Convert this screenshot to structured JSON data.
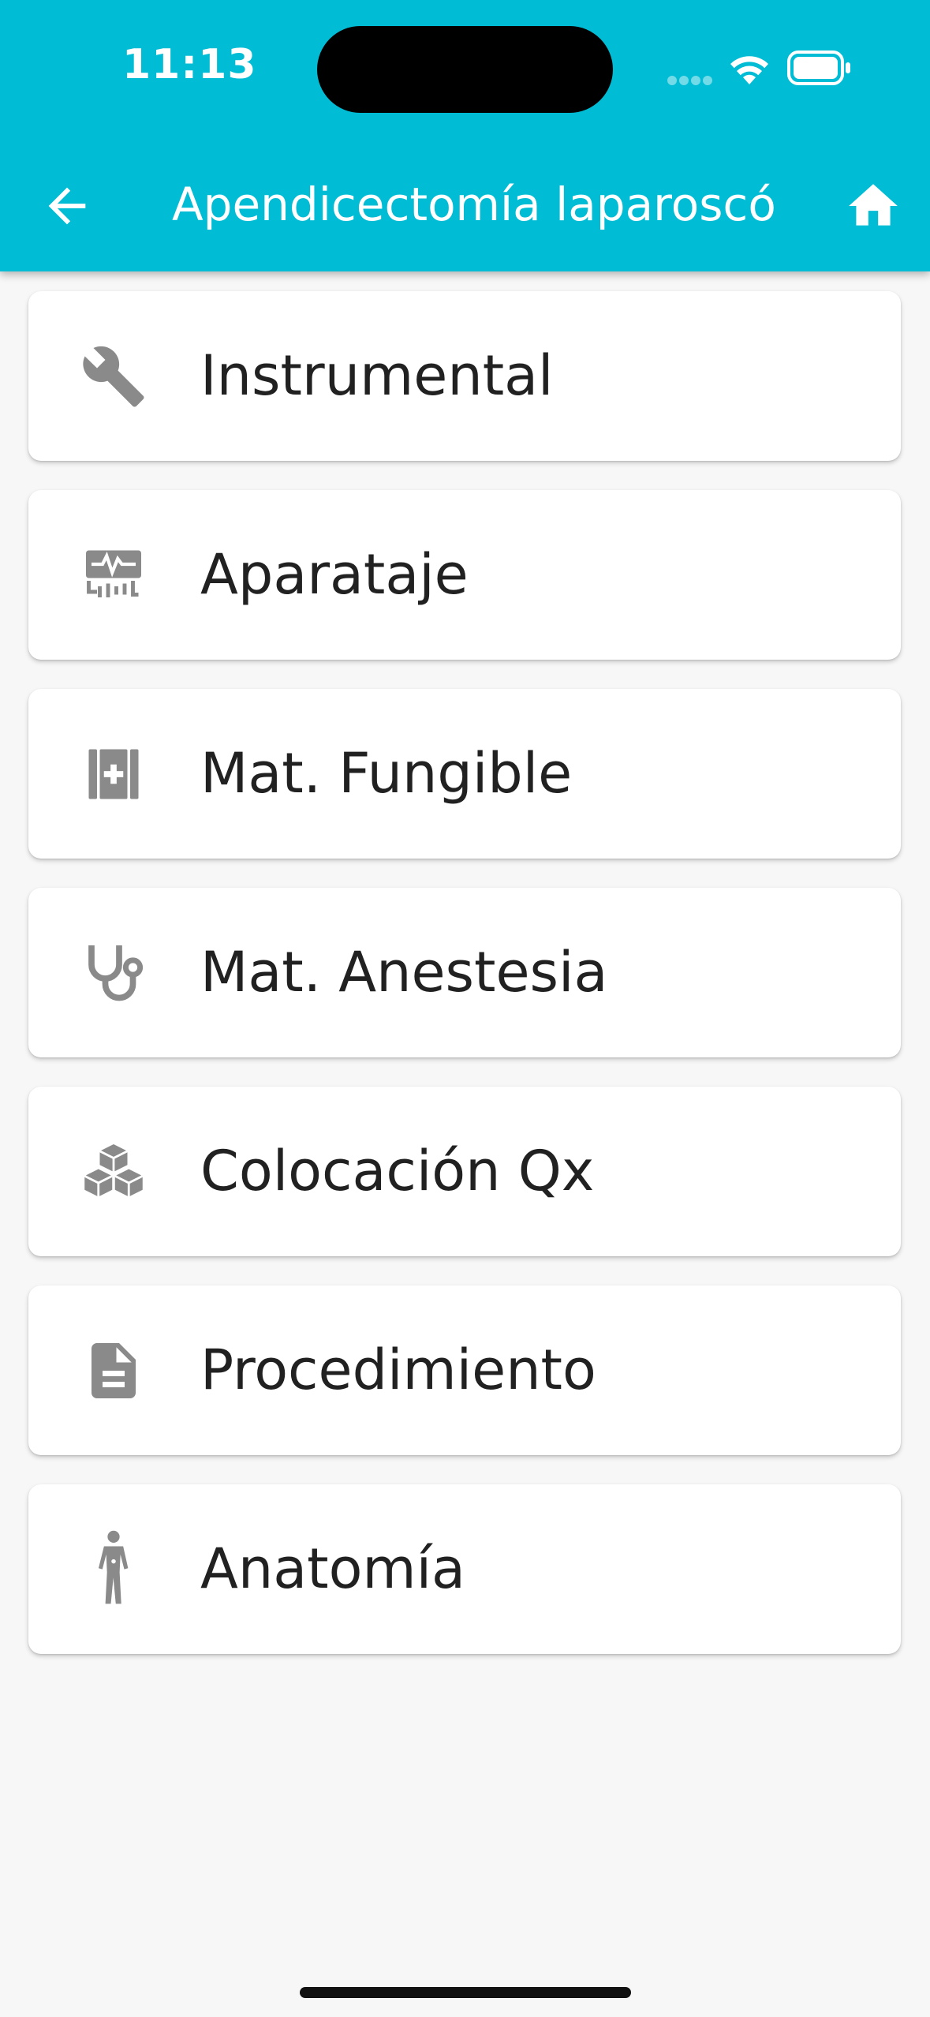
{
  "status_bar": {
    "time": "11:13"
  },
  "app_bar": {
    "title": "Apendicectomía laparoscó",
    "color": "#00bcd4"
  },
  "menu": {
    "items": [
      {
        "label": "Instrumental",
        "icon": "wrench-icon"
      },
      {
        "label": "Aparataje",
        "icon": "monitor-icon"
      },
      {
        "label": "Mat. Fungible",
        "icon": "medical-kit-icon"
      },
      {
        "label": "Mat. Anestesia",
        "icon": "stethoscope-icon"
      },
      {
        "label": "Colocación Qx",
        "icon": "cubes-icon"
      },
      {
        "label": "Procedimiento",
        "icon": "document-icon"
      },
      {
        "label": "Anatomía",
        "icon": "human-body-icon"
      }
    ]
  }
}
